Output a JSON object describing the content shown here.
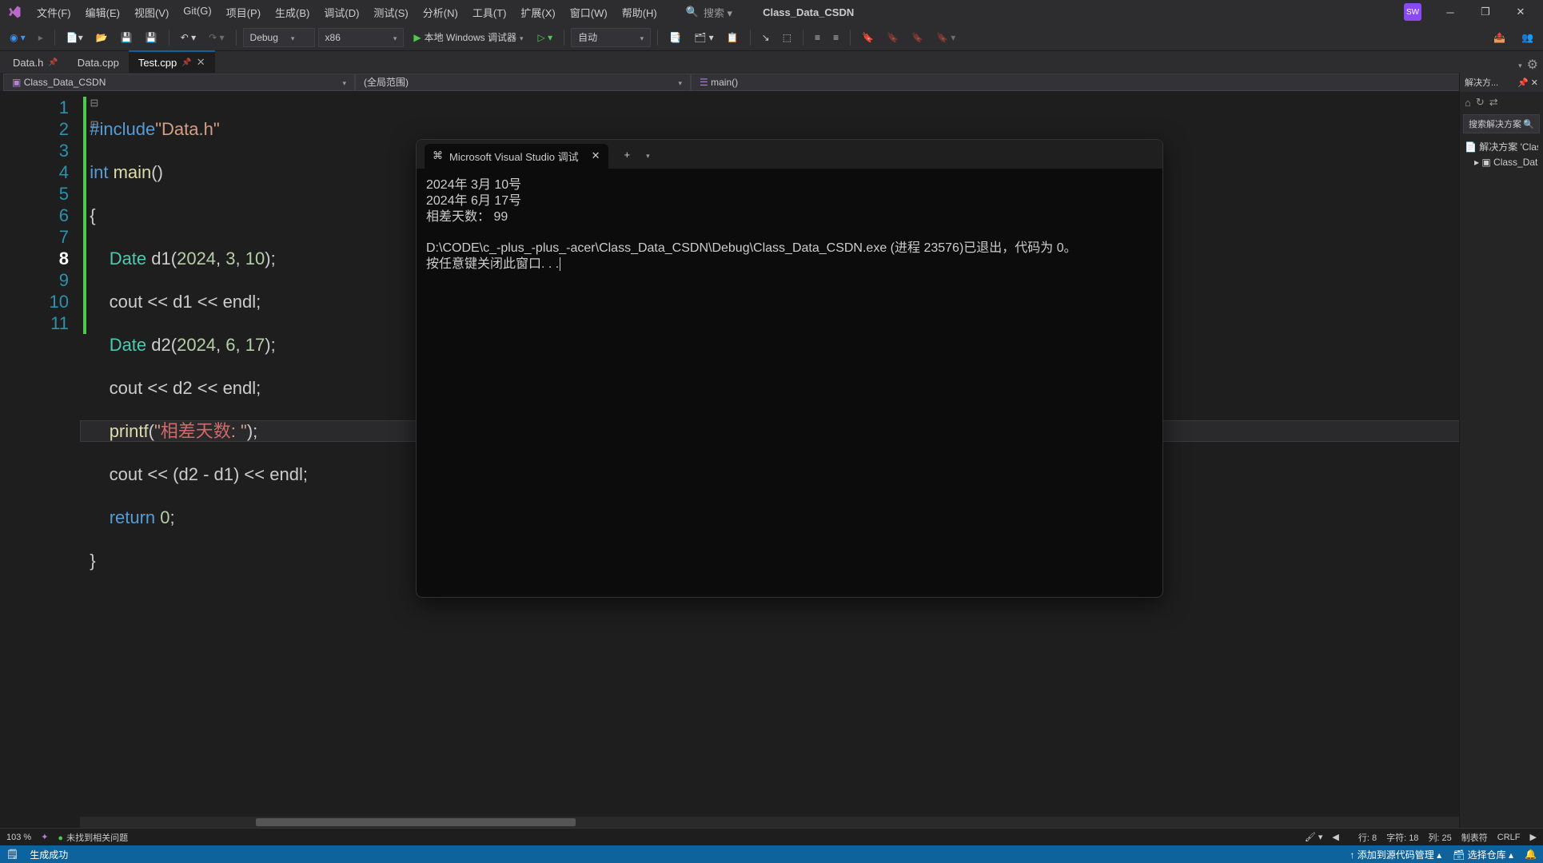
{
  "title": {
    "project": "Class_Data_CSDN",
    "avatar": "SW"
  },
  "menu": [
    "文件(F)",
    "编辑(E)",
    "视图(V)",
    "Git(G)",
    "项目(P)",
    "生成(B)",
    "调试(D)",
    "测试(S)",
    "分析(N)",
    "工具(T)",
    "扩展(X)",
    "窗口(W)",
    "帮助(H)"
  ],
  "search": {
    "placeholder": "搜索 ▾"
  },
  "toolbar": {
    "config": "Debug",
    "platform": "x86",
    "debugger": "本地 Windows 调试器",
    "auto": "自动"
  },
  "tabs": [
    {
      "label": "Data.h",
      "pinned": true,
      "active": false
    },
    {
      "label": "Data.cpp",
      "pinned": false,
      "active": false
    },
    {
      "label": "Test.cpp",
      "pinned": true,
      "active": true
    }
  ],
  "crumbs": {
    "project": "Class_Data_CSDN",
    "scope": "(全局范围)",
    "func": "main()"
  },
  "code": {
    "lines": [
      1,
      2,
      3,
      4,
      5,
      6,
      7,
      8,
      9,
      10,
      11
    ],
    "current": 8
  },
  "console": {
    "tab": "Microsoft Visual Studio 调试",
    "out1": "2024年 3月 10号",
    "out2": "2024年 6月 17号",
    "out3": "相差天数： 99",
    "out4": "D:\\CODE\\c_-plus_-plus_-acer\\Class_Data_CSDN\\Debug\\Class_Data_CSDN.exe (进程 23576)已退出，代码为 0。",
    "out5": "按任意键关闭此窗口. . ."
  },
  "status": {
    "zoom": "103 %",
    "issues": "未找到相关问题",
    "line": "行: 8",
    "char": "字符: 18",
    "col": "列: 25",
    "tabs": "制表符",
    "eol": "CRLF"
  },
  "bottom": {
    "build": "生成成功",
    "scm": "添加到源代码管理",
    "repo": "选择仓库"
  },
  "explorer": {
    "title": "解决方...",
    "search": "搜索解决方案",
    "sol": "解决方案 'Clas",
    "proj": "Class_Data"
  }
}
